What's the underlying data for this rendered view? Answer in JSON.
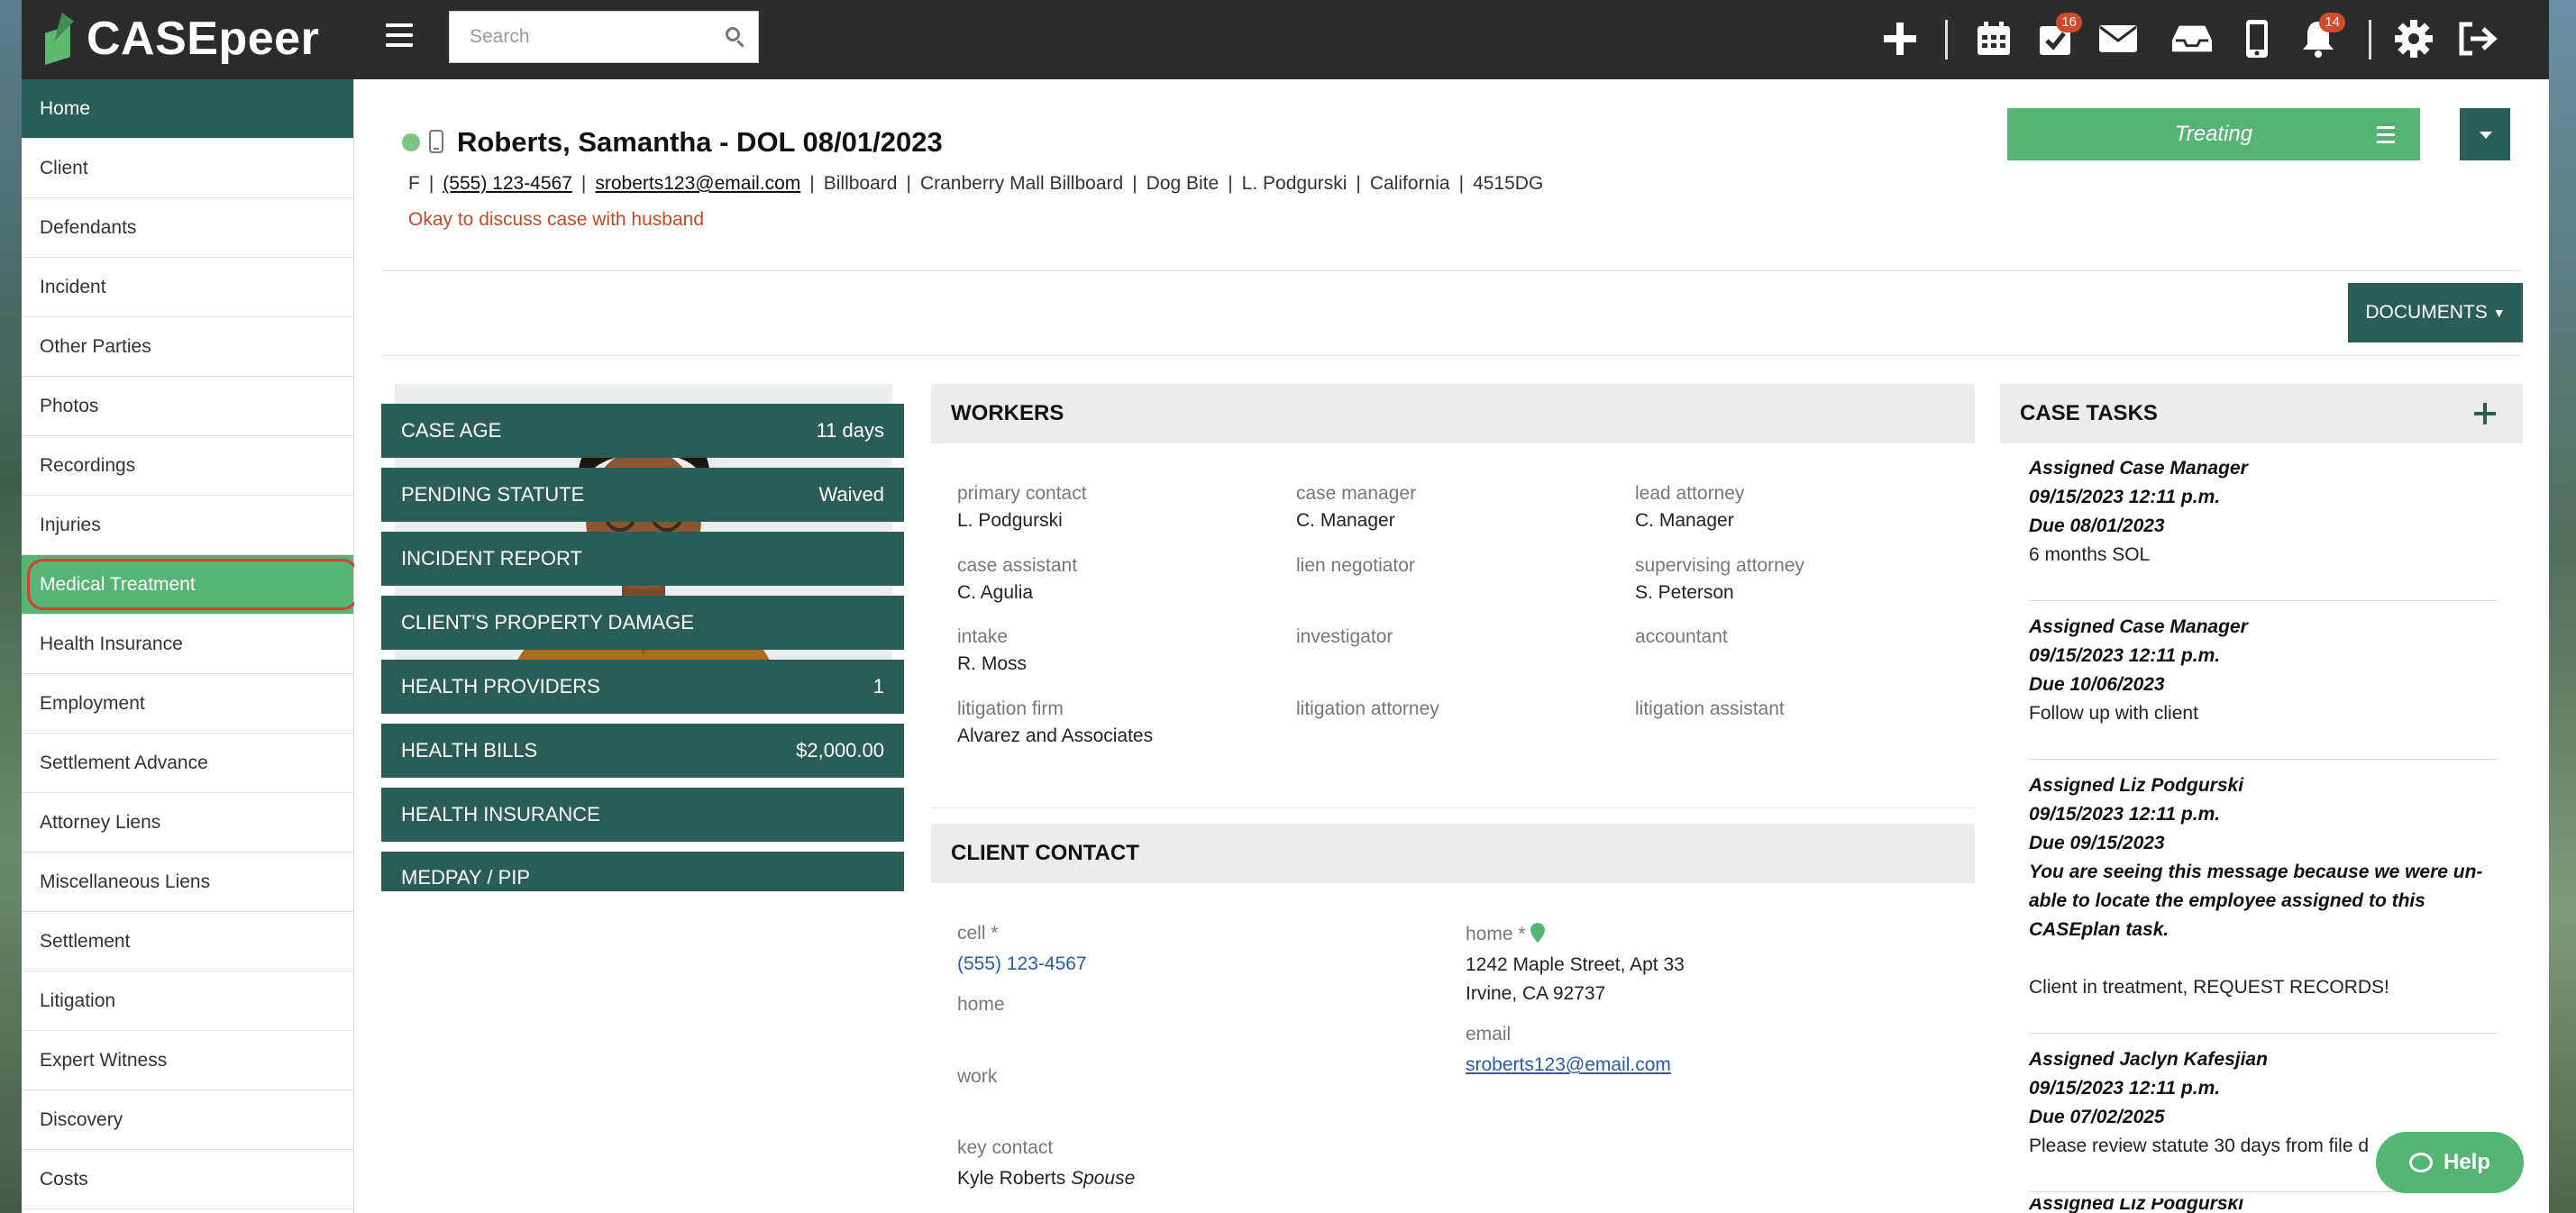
{
  "app": {
    "name": "CASEpeer"
  },
  "search": {
    "placeholder": "Search"
  },
  "topbar": {
    "tasks_badge": "16",
    "notifications_badge": "14"
  },
  "sidebar": {
    "items": [
      {
        "label": "Home"
      },
      {
        "label": "Client"
      },
      {
        "label": "Defendants"
      },
      {
        "label": "Incident"
      },
      {
        "label": "Other Parties"
      },
      {
        "label": "Photos"
      },
      {
        "label": "Recordings"
      },
      {
        "label": "Injuries"
      },
      {
        "label": "Medical Treatment"
      },
      {
        "label": "Health Insurance"
      },
      {
        "label": "Employment"
      },
      {
        "label": "Settlement Advance"
      },
      {
        "label": "Attorney Liens"
      },
      {
        "label": "Miscellaneous Liens"
      },
      {
        "label": "Settlement"
      },
      {
        "label": "Litigation"
      },
      {
        "label": "Expert Witness"
      },
      {
        "label": "Discovery"
      },
      {
        "label": "Costs"
      }
    ]
  },
  "client": {
    "name": "Roberts, Samantha - DOL 08/01/2023",
    "gender": "F",
    "phone": "(555) 123-4567",
    "email": "sroberts123@email.com",
    "source": "Billboard",
    "source_detail": "Cranberry Mall Billboard",
    "case_type": "Dog Bite",
    "attorney": "L. Podgurski",
    "state": "California",
    "case_id": "4515DG",
    "note": "Okay to discuss case with husband"
  },
  "status": {
    "label": "Treating"
  },
  "documents": {
    "label": "DOCUMENTS"
  },
  "stats": [
    {
      "label": "CASE AGE",
      "value": "11 days"
    },
    {
      "label": "PENDING STATUTE",
      "value": "Waived"
    },
    {
      "label": "INCIDENT REPORT",
      "value": ""
    },
    {
      "label": "CLIENT'S PROPERTY DAMAGE",
      "value": ""
    },
    {
      "label": "HEALTH PROVIDERS",
      "value": "1"
    },
    {
      "label": "HEALTH BILLS",
      "value": "$2,000.00"
    },
    {
      "label": "HEALTH INSURANCE",
      "value": ""
    },
    {
      "label": "MEDPAY / PIP",
      "value": ""
    }
  ],
  "workers": {
    "title": "WORKERS",
    "rows": [
      [
        {
          "label": "primary contact",
          "value": "L. Podgurski"
        },
        {
          "label": "case manager",
          "value": "C. Manager"
        },
        {
          "label": "lead attorney",
          "value": "C. Manager"
        }
      ],
      [
        {
          "label": "case assistant",
          "value": "C. Agulia"
        },
        {
          "label": "lien negotiator",
          "value": ""
        },
        {
          "label": "supervising attorney",
          "value": "S. Peterson"
        }
      ],
      [
        {
          "label": "intake",
          "value": "R. Moss"
        },
        {
          "label": "investigator",
          "value": ""
        },
        {
          "label": "accountant",
          "value": ""
        }
      ],
      [
        {
          "label": "litigation firm",
          "value": "Alvarez and Associates"
        },
        {
          "label": "litigation attorney",
          "value": ""
        },
        {
          "label": "litigation assistant",
          "value": ""
        }
      ]
    ]
  },
  "contact": {
    "title": "CLIENT CONTACT",
    "cell_label": "cell *",
    "cell_value": "(555) 123-4567",
    "home_label": "home",
    "work_label": "work",
    "key_contact_label": "key contact",
    "key_contact_name": "Kyle Roberts",
    "key_contact_relation": "Spouse",
    "home_addr_label": "home *",
    "home_addr_line1": "1242 Maple Street, Apt 33",
    "home_addr_line2": "Irvine, CA 92737",
    "email_label": "email",
    "email_value": "sroberts123@email.com"
  },
  "tasks": {
    "title": "CASE TASKS",
    "items": [
      {
        "assigned": "Assigned Case Manager",
        "date": "09/15/2023 12:11 p.m.",
        "due": "Due 08/01/2023",
        "text": "6 months SOL"
      },
      {
        "assigned": "Assigned Case Manager",
        "date": "09/15/2023 12:11 p.m.",
        "due": "Due 10/06/2023",
        "text": "Follow up with client"
      },
      {
        "assigned": "Assigned Liz Podgurski",
        "date": "09/15/2023 12:11 p.m.",
        "due": "Due 09/15/2023",
        "warning": "You are seeing this message because we were un-able to locate the employee assigned to this CASEplan task.",
        "text": "Client in treatment, REQUEST RECORDS!"
      },
      {
        "assigned": "Assigned Jaclyn Kafesjian",
        "date": "09/15/2023 12:11 p.m.",
        "due": "Due 07/02/2025",
        "text": "Please review statute 30 days from file d"
      },
      {
        "assigned": "Assigned Liz Podgurski",
        "date": "",
        "due": "",
        "text": ""
      }
    ]
  },
  "help": {
    "label": "Help"
  }
}
